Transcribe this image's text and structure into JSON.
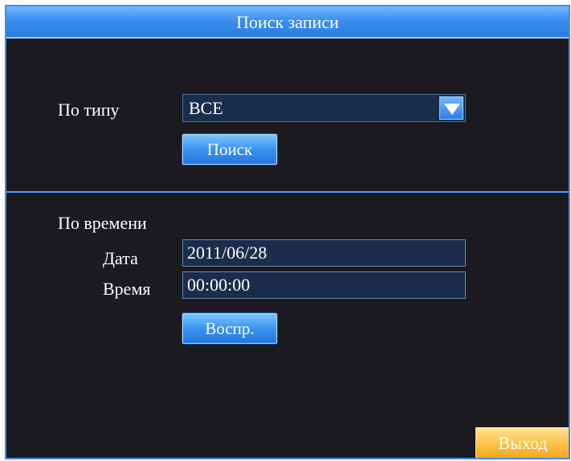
{
  "window": {
    "title": "Поиск записи"
  },
  "search_by_type": {
    "label": "По типу",
    "selected_value": "ВСЕ",
    "search_button": "Поиск"
  },
  "search_by_time": {
    "section_label": "По времени",
    "date_label": "Дата",
    "date_value": "2011/06/28",
    "time_label": "Время",
    "time_value": "00:00:00",
    "play_button": "Воспр."
  },
  "footer": {
    "exit_button": "Выход"
  },
  "icons": {
    "dropdown_arrow": "chevron-down-icon"
  },
  "colors": {
    "background": "#1b1a20",
    "accent_blue": "#3d8fe6",
    "exit_orange": "#ffc24a"
  }
}
